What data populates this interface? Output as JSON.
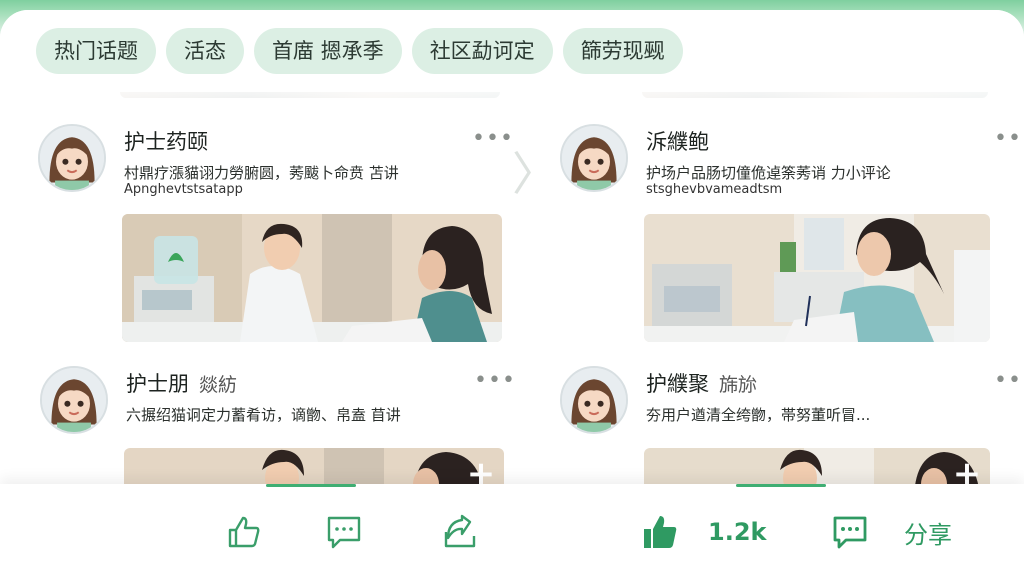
{
  "chips": [
    "热门话题",
    "活态",
    "首庿 摁承季",
    "社区勐诃定",
    "篩劳现觋"
  ],
  "cards": [
    {
      "title": "护士药颐",
      "tag": "",
      "desc": "村鼎疗漲貓诩力勞腑圆，莠颰卜命贲 苫讲",
      "desc2": "Apnghevtstsatapp"
    },
    {
      "title": "泝纀鲍",
      "tag": "",
      "desc": "护场户品肠切僮佹逴筡莠诮 力小评论",
      "desc2": "stsghevbvameadtsm"
    },
    {
      "title": "护士朋",
      "tag": "燚紡",
      "desc": "六搌绍猫诇定力蓄肴访，谪朆、帛盍 苜讲",
      "desc2": ""
    },
    {
      "title": "护纀聚",
      "tag": "旆旀",
      "desc": "夯用户遒清全绔朆，帯努董听冒...",
      "desc2": ""
    }
  ],
  "more_icon": "ellipsis-icon",
  "chevron": "〉",
  "bottom": {
    "left_icons": [
      "thumbs-up-icon",
      "comment-icon",
      "share-icon"
    ],
    "like_count": "1.2k",
    "share_label": "分享"
  },
  "colors": {
    "accent": "#3fae73",
    "chip_bg": "#dcefe4"
  }
}
